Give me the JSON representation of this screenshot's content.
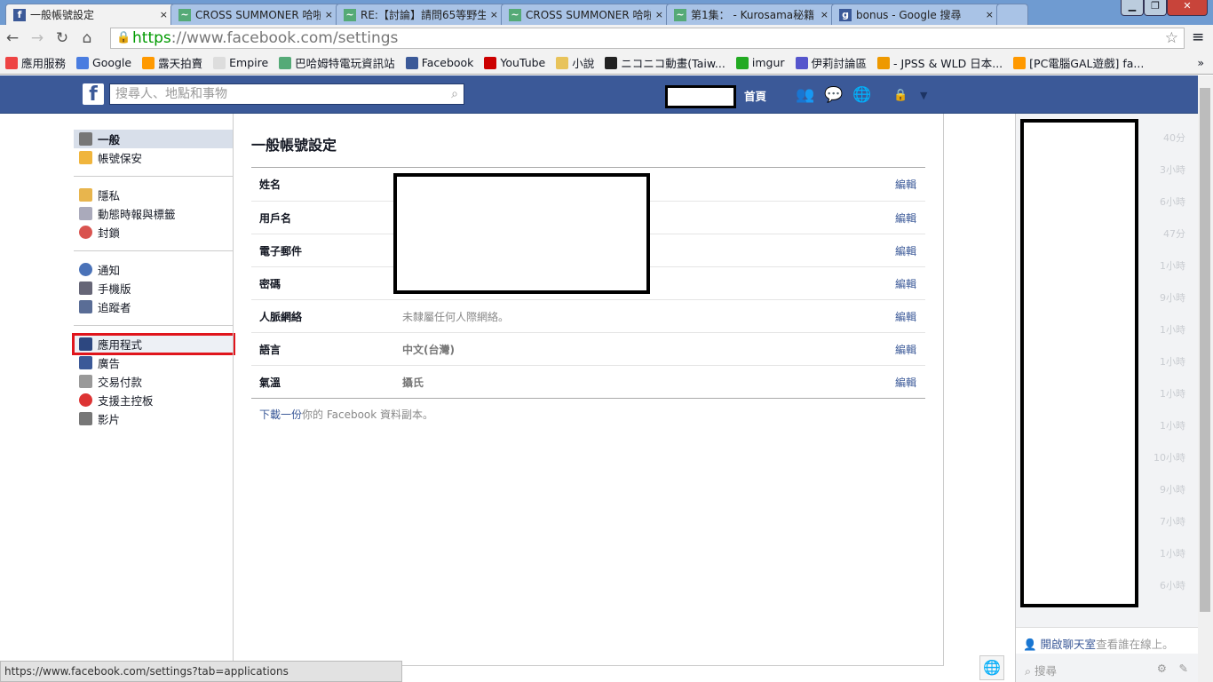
{
  "browser": {
    "tabs": [
      {
        "title": "一般帳號設定",
        "active": true
      },
      {
        "title": "CROSS SUMMONER 哈啦"
      },
      {
        "title": "RE:【討論】請問65等野生"
      },
      {
        "title": "CROSS SUMMONER 哈啦"
      },
      {
        "title": "第1集： - Kurosama秘籍"
      },
      {
        "title": "bonus - Google 搜尋"
      }
    ],
    "close_glyph": "×",
    "url_scheme": "https",
    "url_rest": "://www.facebook.com/settings",
    "bookmarks": [
      "應用服務",
      "Google",
      "露天拍賣",
      "Empire",
      "巴哈姆特電玩資訊站",
      "Facebook",
      "YouTube",
      "小說",
      "ニコニコ動畫(Taiw...",
      "imgur",
      "伊莉討論區",
      "- JPSS & WLD 日本...",
      "[PC電腦GAL遊戲] fa..."
    ],
    "bookmark_overflow": "»",
    "status_url": "https://www.facebook.com/settings?tab=applications"
  },
  "fb": {
    "search_placeholder": "搜尋人、地點和事物",
    "home": "首頁",
    "brand_color": "#3b5998"
  },
  "leftnav": {
    "groups": [
      [
        {
          "label": "一般",
          "icon": "gears-icon",
          "selected": true
        },
        {
          "label": "帳號保安",
          "icon": "shield-icon"
        }
      ],
      [
        {
          "label": "隱私",
          "icon": "lock-icon"
        },
        {
          "label": "動態時報與標籤",
          "icon": "timeline-icon"
        },
        {
          "label": "封鎖",
          "icon": "block-icon"
        }
      ],
      [
        {
          "label": "通知",
          "icon": "globe-icon"
        },
        {
          "label": "手機版",
          "icon": "mobile-icon"
        },
        {
          "label": "追蹤者",
          "icon": "rss-icon"
        }
      ],
      [
        {
          "label": "應用程式",
          "icon": "apps-icon",
          "highlighted": true
        },
        {
          "label": "廣告",
          "icon": "ads-icon"
        },
        {
          "label": "交易付款",
          "icon": "card-icon"
        },
        {
          "label": "支援主控板",
          "icon": "lifebuoy-icon"
        },
        {
          "label": "影片",
          "icon": "film-icon"
        }
      ]
    ]
  },
  "main": {
    "title": "一般帳號設定",
    "edit_label": "編輯",
    "rows": [
      {
        "key": "姓名",
        "value": ""
      },
      {
        "key": "用戶名",
        "value": ""
      },
      {
        "key": "電子郵件",
        "value": ""
      },
      {
        "key": "密碼",
        "value": ""
      },
      {
        "key": "人脈網絡",
        "value": "未隸屬任何人際網絡。"
      },
      {
        "key": "語言",
        "value": "中文(台灣)"
      },
      {
        "key": "氣溫",
        "value": "攝氏"
      }
    ],
    "download_link": "下載一份",
    "download_rest": "你的 Facebook 資料副本。"
  },
  "chat": {
    "times": [
      "40分",
      "3小時",
      "6小時",
      "47分",
      "1小時",
      "9小時",
      "1小時",
      "1小時",
      "1小時",
      "1小時",
      "10小時",
      "9小時",
      "7小時",
      "1小時",
      "6小時"
    ],
    "turn_on_link": "開啟聊天室",
    "turn_on_rest": "查看誰在線上。",
    "search_placeholder": "搜尋"
  }
}
